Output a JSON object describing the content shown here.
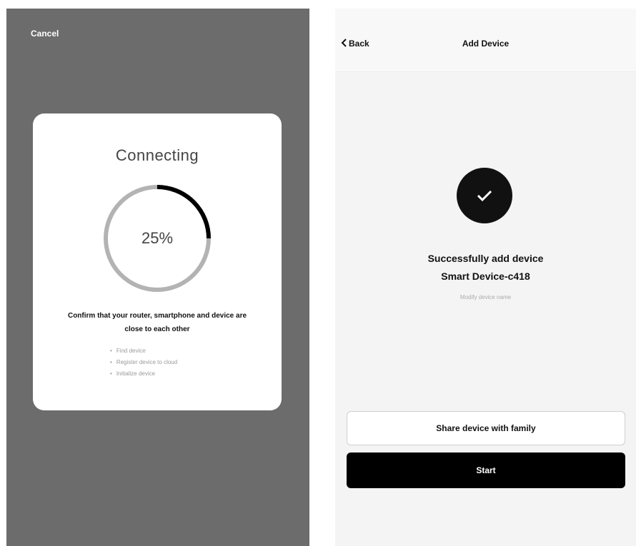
{
  "connecting_screen": {
    "cancel_label": "Cancel",
    "dialog": {
      "title": "Connecting",
      "progress_text": "25%",
      "progress_fraction": 0.25,
      "confirm_text": "Confirm that your router, smartphone and device are close to each other",
      "tips": [
        "Find device",
        "Register device to cloud",
        "Initialize device"
      ]
    }
  },
  "add_device_screen": {
    "nav": {
      "back_label": "Back",
      "title": "Add Device"
    },
    "success_title": "Successfully add device",
    "device_name": "Smart Device-c418",
    "modify_label": "Modify device name",
    "share_button_label": "Share device with family",
    "start_button_label": "Start"
  },
  "colors": {
    "overlay": "#6c6c6c",
    "progress_track": "#b3b3b3",
    "progress_fill": "#000000",
    "primary_button": "#000000",
    "success_badge": "#111111"
  },
  "icons": {
    "back": "chevron-left-icon",
    "success": "checkmark-icon"
  }
}
